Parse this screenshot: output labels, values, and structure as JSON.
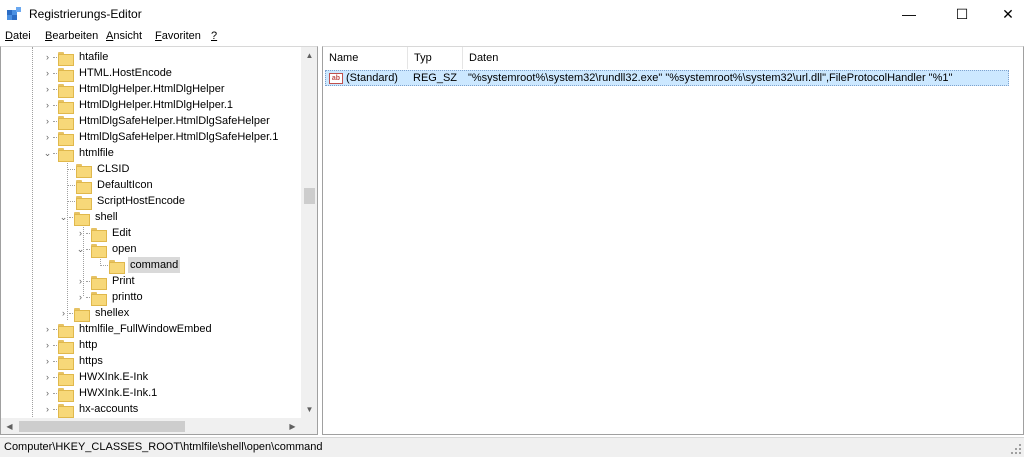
{
  "window": {
    "title": "Registrierungs-Editor",
    "icon": "registry-editor-icon",
    "minimize_glyph": "—",
    "maximize_glyph": "☐",
    "close_glyph": "✕"
  },
  "menu": {
    "items": [
      {
        "accel": "D",
        "rest": "atei"
      },
      {
        "accel": "B",
        "rest": "earbeiten"
      },
      {
        "accel": "A",
        "rest": "nsicht"
      },
      {
        "accel": "F",
        "rest": "avoriten"
      },
      {
        "accel": "?",
        "rest": ""
      }
    ]
  },
  "tree": {
    "nodes": [
      {
        "label": "htafile",
        "expander": "›"
      },
      {
        "label": "HTML.HostEncode",
        "expander": "›"
      },
      {
        "label": "HtmlDlgHelper.HtmlDlgHelper",
        "expander": "›"
      },
      {
        "label": "HtmlDlgHelper.HtmlDlgHelper.1",
        "expander": "›"
      },
      {
        "label": "HtmlDlgSafeHelper.HtmlDlgSafeHelper",
        "expander": "›"
      },
      {
        "label": "HtmlDlgSafeHelper.HtmlDlgSafeHelper.1",
        "expander": "›"
      },
      {
        "label": "htmlfile",
        "expander": "⌄"
      },
      {
        "label": "CLSID",
        "expander": ""
      },
      {
        "label": "DefaultIcon",
        "expander": ""
      },
      {
        "label": "ScriptHostEncode",
        "expander": ""
      },
      {
        "label": "shell",
        "expander": "⌄"
      },
      {
        "label": "Edit",
        "expander": "›"
      },
      {
        "label": "open",
        "expander": "⌄"
      },
      {
        "label": "command",
        "expander": "",
        "selected": true
      },
      {
        "label": "Print",
        "expander": "›"
      },
      {
        "label": "printto",
        "expander": "›"
      },
      {
        "label": "shellex",
        "expander": "›"
      },
      {
        "label": "htmlfile_FullWindowEmbed",
        "expander": "›"
      },
      {
        "label": "http",
        "expander": "›"
      },
      {
        "label": "https",
        "expander": "›"
      },
      {
        "label": "HWXInk.E-Ink",
        "expander": "›"
      },
      {
        "label": "HWXInk.E-Ink.1",
        "expander": "›"
      },
      {
        "label": "hx-accounts",
        "expander": "›"
      }
    ],
    "scroll_up": "▲",
    "scroll_down": "▼",
    "scroll_left": "◀",
    "scroll_right": "▶"
  },
  "list": {
    "columns": {
      "name": "Name",
      "type": "Typ",
      "data": "Daten"
    },
    "rows": [
      {
        "icon_text": "ab",
        "name": "(Standard)",
        "type": "REG_SZ",
        "data": "\"%systemroot%\\system32\\rundll32.exe\" \"%systemroot%\\system32\\url.dll\",FileProtocolHandler \"%1\""
      }
    ]
  },
  "status": {
    "path": "Computer\\HKEY_CLASSES_ROOT\\htmlfile\\shell\\open\\command"
  }
}
